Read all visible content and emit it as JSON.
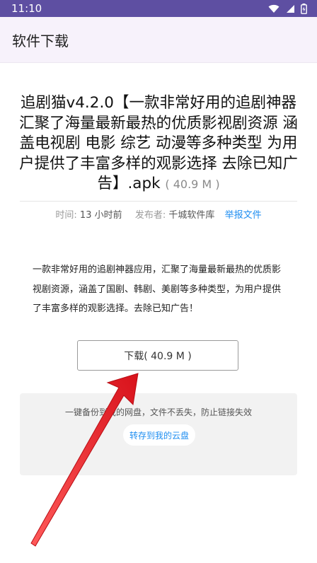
{
  "status_bar": {
    "time": "11:10",
    "icons": [
      "wifi-icon",
      "signal-icon",
      "battery-icon"
    ]
  },
  "app_bar": {
    "title": "软件下载"
  },
  "file": {
    "title": "追剧猫v4.2.0【一款非常好用的追剧神器 汇聚了海量最新最热的优质影视剧资源 涵盖电视剧 电影 综艺 动漫等多种类型 为用户提供了丰富多样的观影选择 去除已知广告】.apk",
    "size_label": "( 40.9 M )"
  },
  "meta": {
    "time_label": "时间:",
    "time_value": "13 小时前",
    "publisher_label": "发布者:",
    "publisher_value": "千城软件库",
    "report_link": "举报文件"
  },
  "description": "一款非常好用的追剧神器应用，汇聚了海量最新最热的优质影视剧资源，涵盖了国剧、韩剧、美剧等多种类型，为用户提供了丰富多样的观影选择。去除已知广告！",
  "download_button": "下载( 40.9 M )",
  "cloud": {
    "message": "一键备份到我的网盘，文件不丢失，防止链接失效",
    "save_button": "转存到我的云盘"
  },
  "colors": {
    "status_bar": "#5e4fa2",
    "app_bar": "#f7f2fb",
    "link": "#1f8ef1",
    "annotation_arrow": "#e8222a"
  }
}
